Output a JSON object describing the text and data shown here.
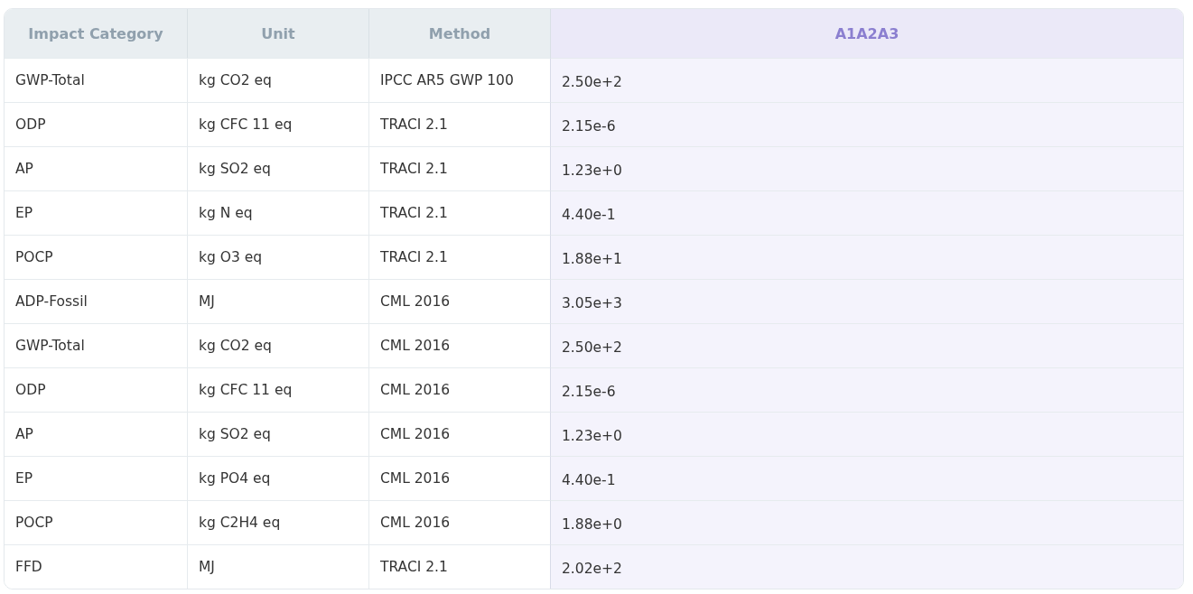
{
  "table": {
    "columns": [
      {
        "label": "Impact Category",
        "highlighted": false
      },
      {
        "label": "Unit",
        "highlighted": false
      },
      {
        "label": "Method",
        "highlighted": false
      },
      {
        "label": "A1A2A3",
        "highlighted": true
      }
    ],
    "rows": [
      [
        "GWP-Total",
        "kg CO2 eq",
        "IPCC AR5 GWP 100",
        "2.50e+2"
      ],
      [
        "ODP",
        "kg CFC 11 eq",
        "TRACI 2.1",
        "2.15e-6"
      ],
      [
        "AP",
        "kg SO2 eq",
        "TRACI 2.1",
        "1.23e+0"
      ],
      [
        "EP",
        "kg N eq",
        "TRACI 2.1",
        "4.40e-1"
      ],
      [
        "POCP",
        "kg O3 eq",
        "TRACI 2.1",
        "1.88e+1"
      ],
      [
        "ADP-Fossil",
        "MJ",
        "CML 2016",
        "3.05e+3"
      ],
      [
        "GWP-Total",
        "kg CO2 eq",
        "CML 2016",
        "2.50e+2"
      ],
      [
        "ODP",
        "kg CFC 11 eq",
        "CML 2016",
        "2.15e-6"
      ],
      [
        "AP",
        "kg SO2 eq",
        "CML 2016",
        "1.23e+0"
      ],
      [
        "EP",
        "kg PO4 eq",
        "CML 2016",
        "4.40e-1"
      ],
      [
        "POCP",
        "kg C2H4 eq",
        "CML 2016",
        "1.88e+0"
      ],
      [
        "FFD",
        "MJ",
        "TRACI 2.1",
        "2.02e+2"
      ]
    ]
  }
}
